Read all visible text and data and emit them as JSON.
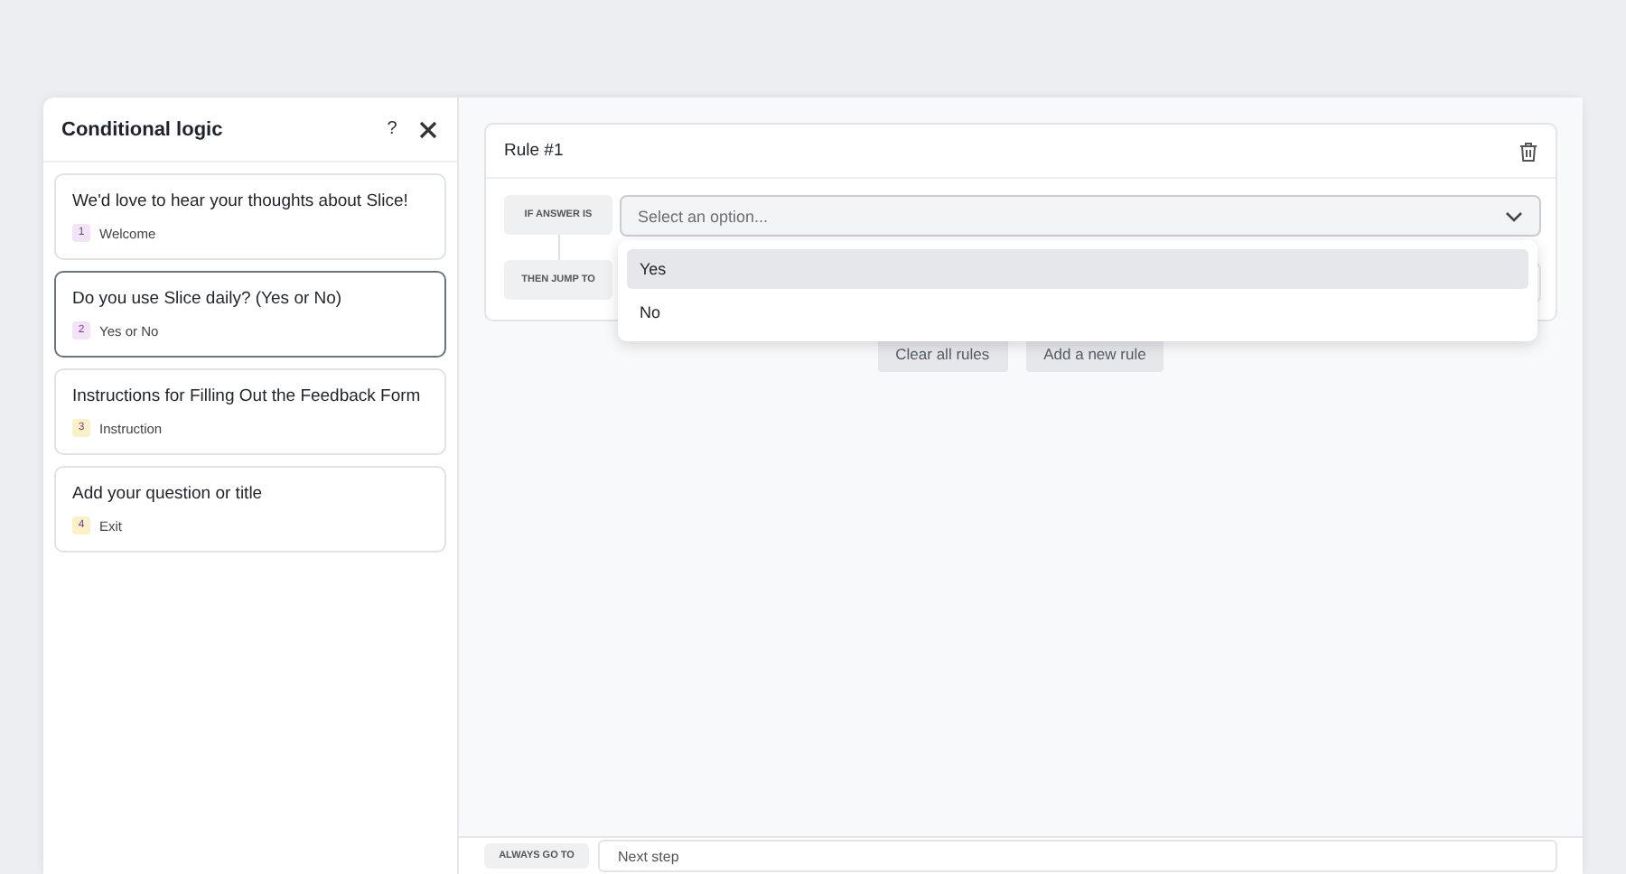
{
  "modal": {
    "title": "Conditional logic",
    "help": "?"
  },
  "steps": [
    {
      "title": "We'd love to hear your thoughts about Slice!",
      "number": "1",
      "type": "Welcome",
      "color": "#f3e3f7",
      "selected": false
    },
    {
      "title": "Do you use Slice daily? (Yes or No)",
      "number": "2",
      "type": "Yes or No",
      "color": "#f3e3f7",
      "selected": true
    },
    {
      "title": "Instructions for Filling Out the Feedback Form",
      "number": "3",
      "type": "Instruction",
      "color": "#fbf1c7",
      "selected": false
    },
    {
      "title": "Add your question or title",
      "number": "4",
      "type": "Exit",
      "color": "#fbf1c7",
      "selected": false
    }
  ],
  "rule": {
    "title": "Rule #1",
    "if_label": "IF ANSWER IS",
    "then_label": "THEN JUMP TO",
    "select_placeholder": "Select an option...",
    "options": [
      {
        "label": "Yes",
        "selected": true
      },
      {
        "label": "No",
        "selected": false
      }
    ]
  },
  "buttons": [
    "Clear all rules",
    "Add a new rule"
  ],
  "footer": {
    "label": "ALWAYS GO TO",
    "value": "Next step"
  }
}
